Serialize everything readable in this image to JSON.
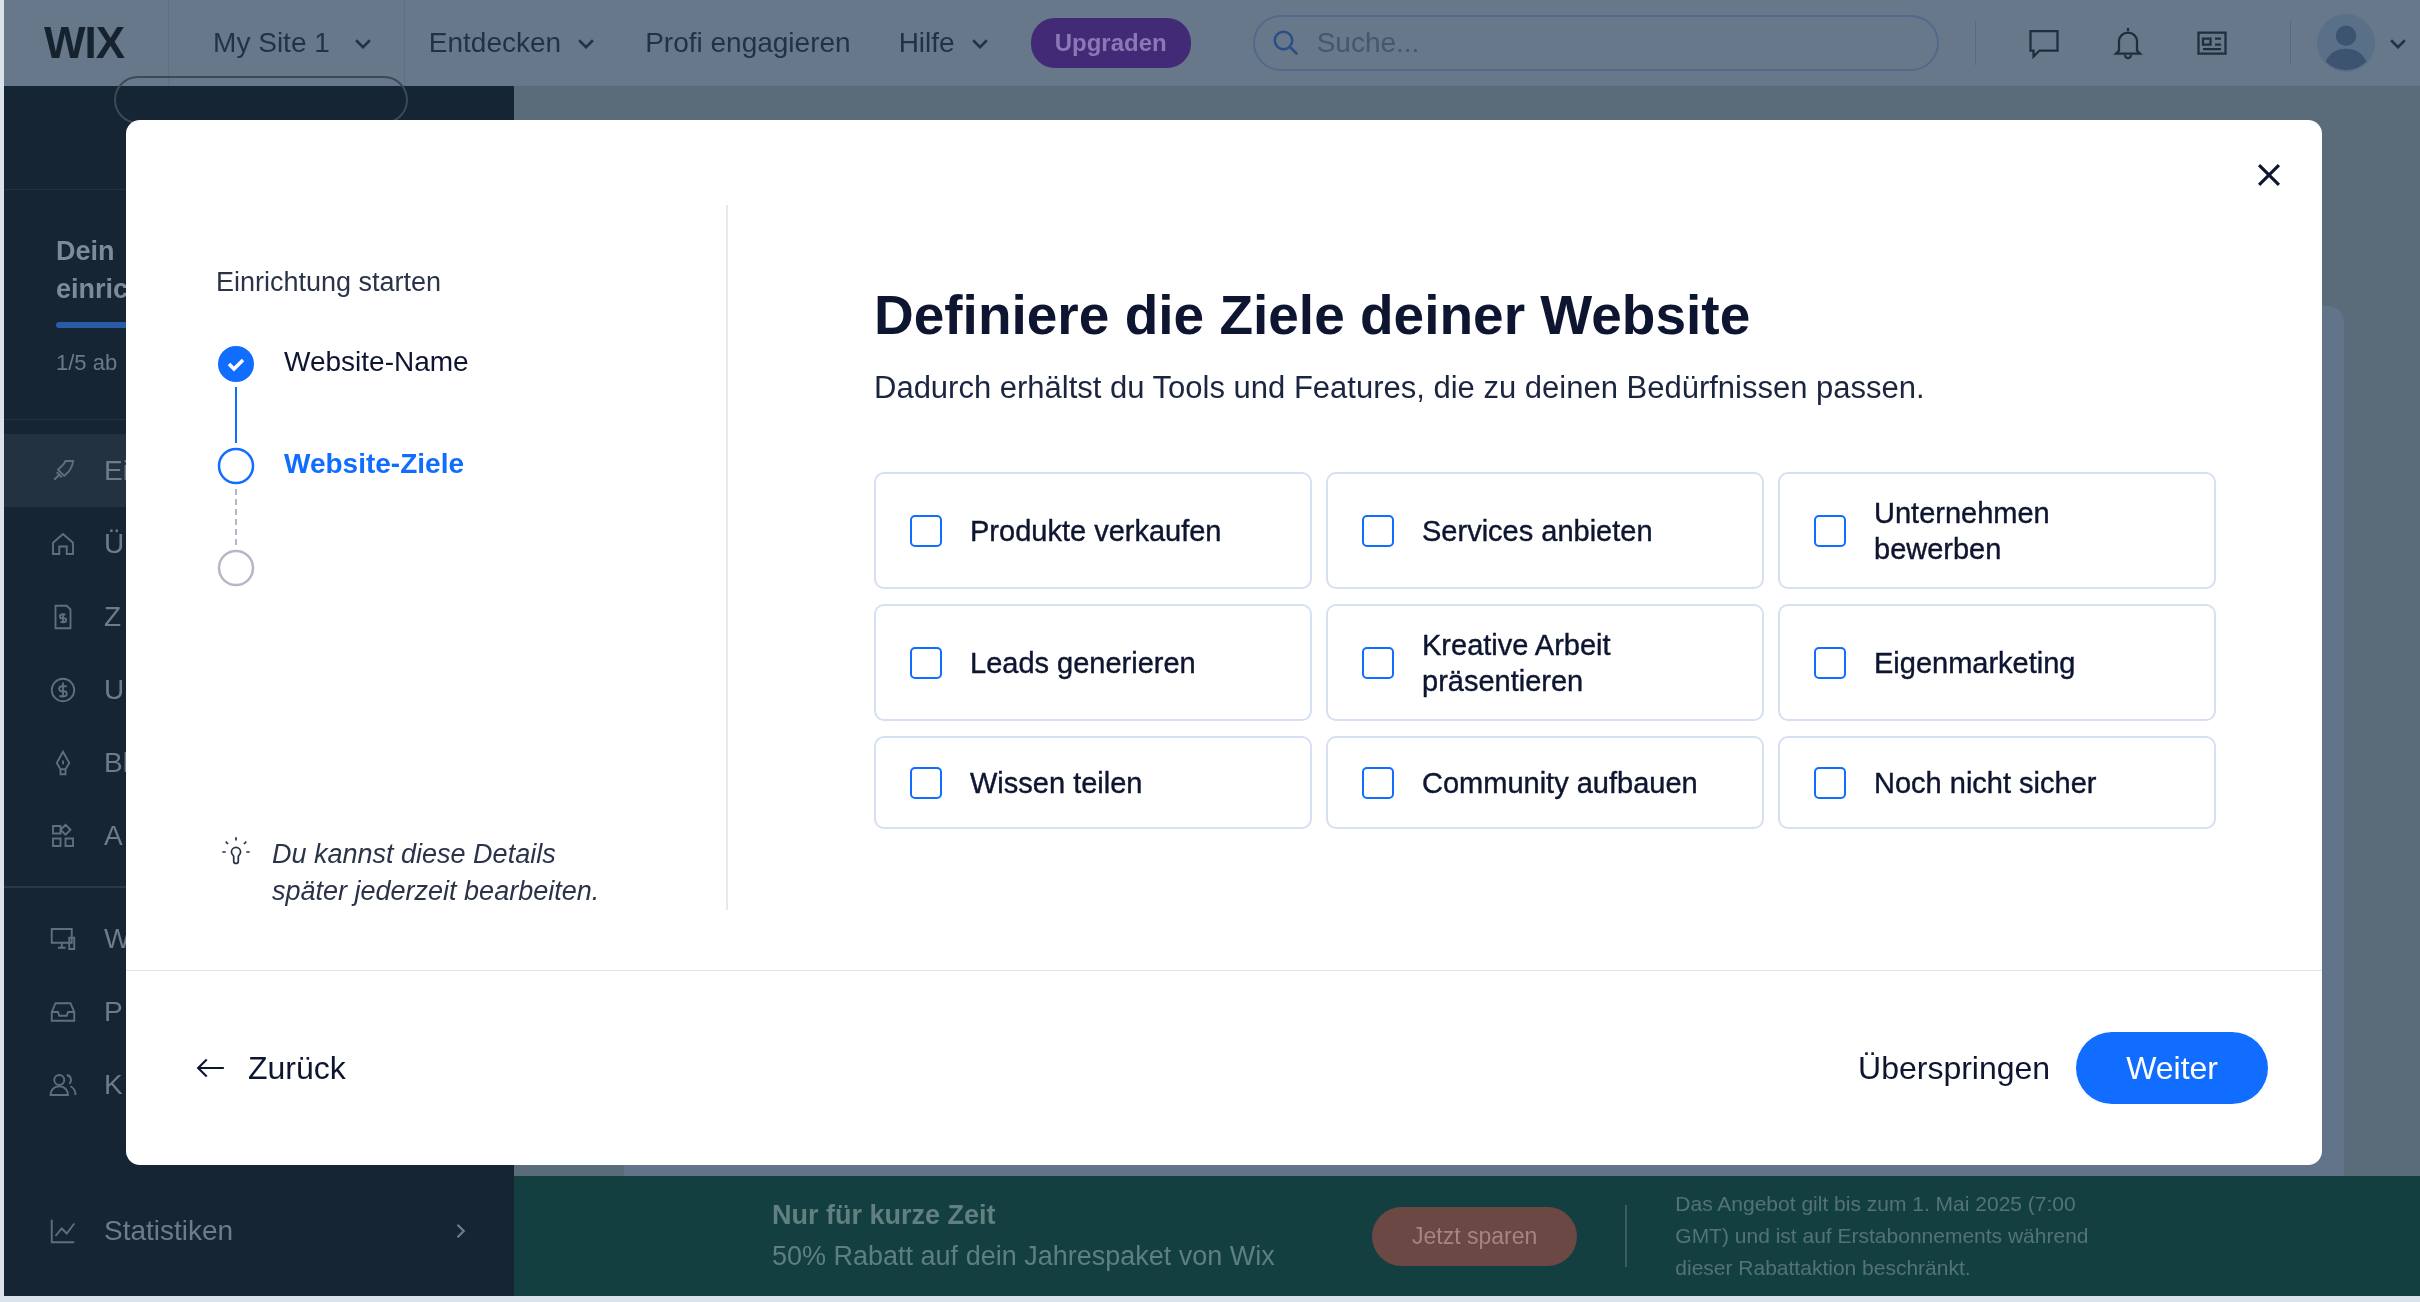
{
  "topbar": {
    "logo": "WIX",
    "site_menu": "My Site 1",
    "nav": [
      {
        "label": "Entdecken",
        "dropdown": true
      },
      {
        "label": "Profi engagieren",
        "dropdown": false
      },
      {
        "label": "Hilfe",
        "dropdown": true
      }
    ],
    "upgrade_button": "Upgraden",
    "search": {
      "placeholder": "Suche..."
    }
  },
  "sidebar": {
    "setup": {
      "title_lines": [
        "Dein",
        "einric"
      ],
      "level": 0.2,
      "progress_text": "1/5 ab"
    },
    "groups": [
      {
        "items": [
          {
            "label": "Ei",
            "selected": true
          },
          {
            "label": "Ü",
            "selected": false
          },
          {
            "label": "Z",
            "selected": false
          },
          {
            "label": "U",
            "selected": false
          },
          {
            "label": "Bl",
            "selected": false
          },
          {
            "label": "A",
            "selected": false
          }
        ]
      },
      {
        "items": [
          {
            "label": "W",
            "selected": false
          },
          {
            "label": "P",
            "selected": false
          },
          {
            "label": "K",
            "selected": false
          },
          {
            "label": "Statistiken",
            "selected": false,
            "expandable": true
          }
        ]
      }
    ]
  },
  "promo_banner": {
    "title": "Nur für kurze Zeit",
    "subtitle": "50% Rabatt auf dein Jahrespaket von Wix",
    "button": "Jetzt sparen",
    "terms": "Das Angebot gilt bis zum 1. Mai 2025 (7:00 GMT) und ist auf Erstabonnements während dieser Rabattaktion beschränkt."
  },
  "dialog": {
    "steps_title": "Einrichtung starten",
    "steps": [
      {
        "label": "Website-Name",
        "kind": "done"
      },
      {
        "label": "Website-Ziele",
        "kind": "current"
      },
      {
        "kind": "upcoming"
      }
    ],
    "hint": "Du kannst diese Details später jederzeit bearbeiten.",
    "title": "Definiere die Ziele deiner Website",
    "subtitle": "Dadurch erhältst du Tools und Features, die zu deinen Bedürfnissen passen.",
    "goals": [
      {
        "label": "Produkte verkaufen",
        "checked": false
      },
      {
        "label": "Services anbieten",
        "checked": false
      },
      {
        "label": "Unternehmen bewerben",
        "checked": false
      },
      {
        "label": "Leads generieren",
        "checked": false
      },
      {
        "label": "Kreative Arbeit präsentieren",
        "checked": false
      },
      {
        "label": "Eigenmarketing",
        "checked": false
      },
      {
        "label": "Wissen teilen",
        "checked": false
      },
      {
        "label": "Community aufbauen",
        "checked": false
      },
      {
        "label": "Noch nicht sicher",
        "checked": false
      }
    ],
    "back_button": "Zurück",
    "skip_button": "Überspringen",
    "next_button": "Weiter"
  }
}
